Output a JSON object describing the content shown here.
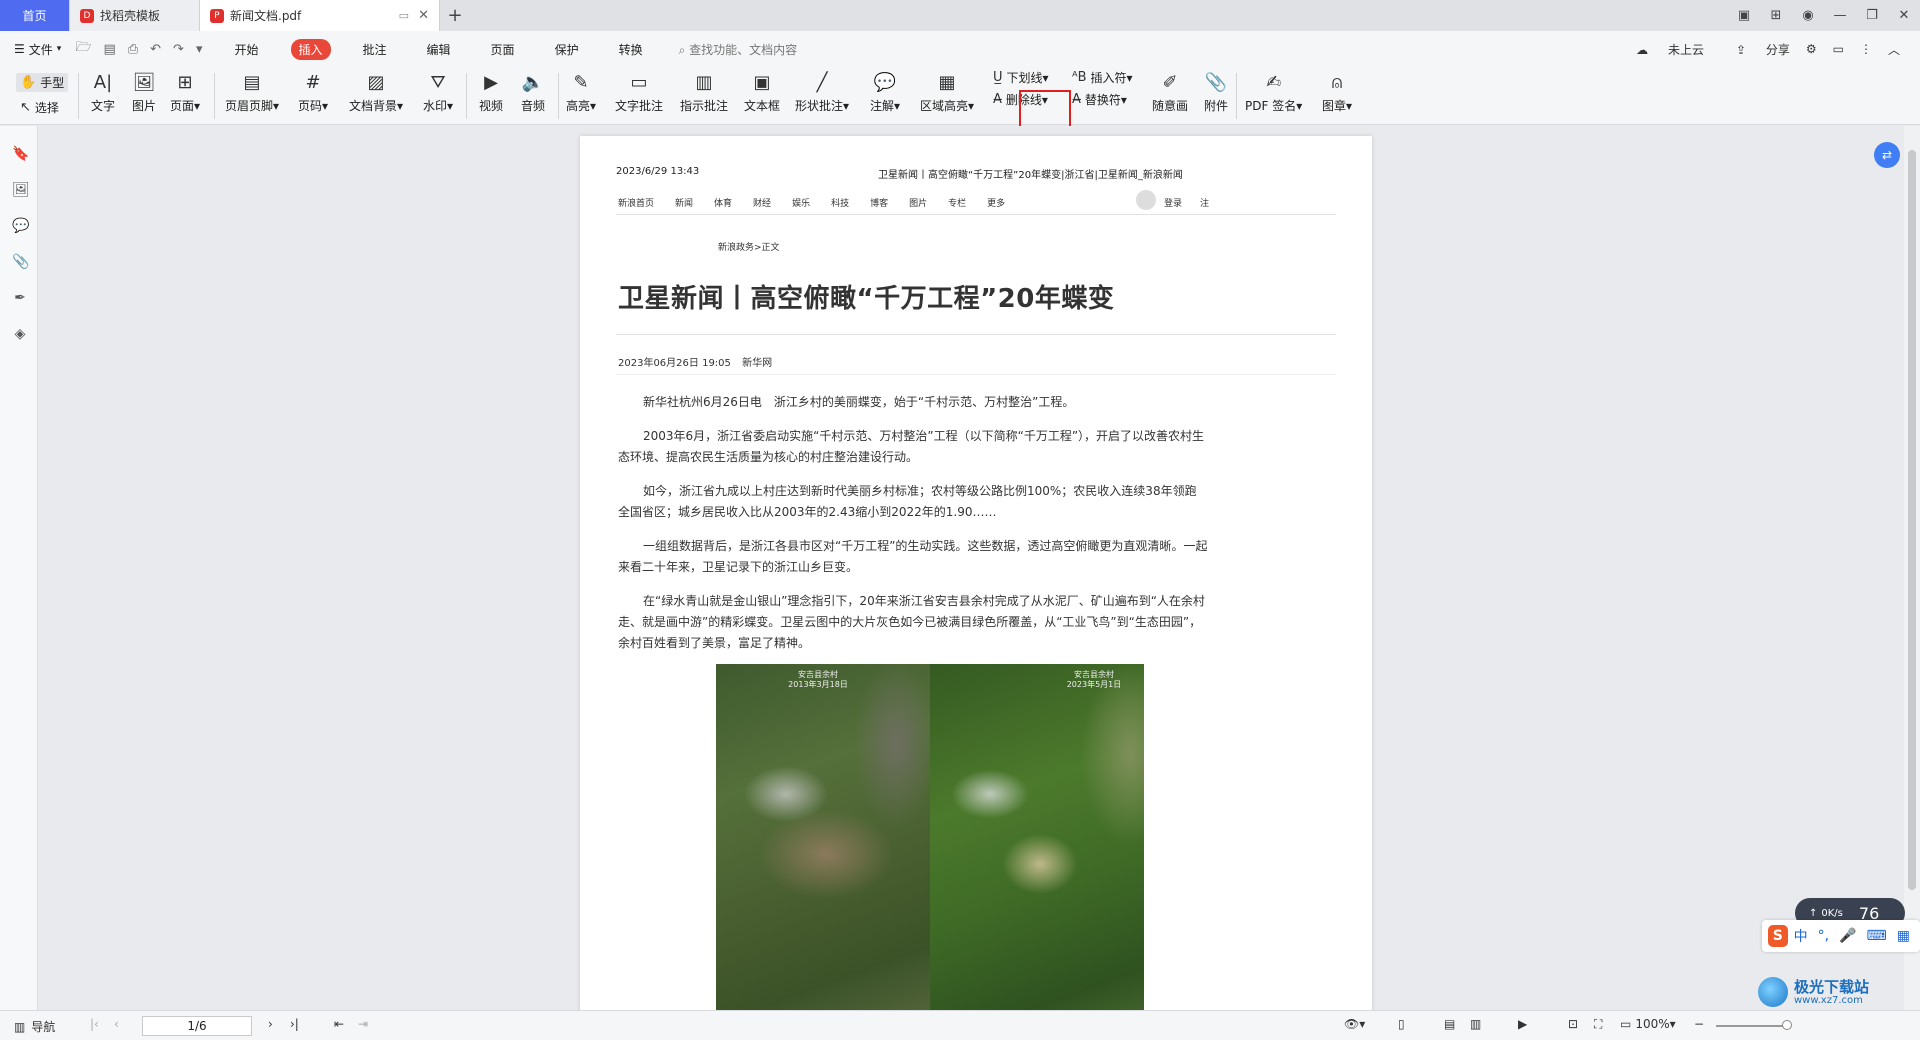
{
  "tabs": {
    "home": "首页",
    "template": "找稻壳模板",
    "doc": "新闻文档.pdf",
    "add": "+"
  },
  "menubar": {
    "file": "文件",
    "tabs": [
      "开始",
      "插入",
      "批注",
      "编辑",
      "页面",
      "保护",
      "转换"
    ],
    "active_tab": "插入",
    "search": "查找功能、文档内容",
    "cloud": "未上云",
    "share": "分享"
  },
  "toolbar": {
    "hand": "手型",
    "select": "选择",
    "items": [
      "文字",
      "图片",
      "页面",
      "页眉页脚",
      "页码",
      "文档背景",
      "水印",
      "视频",
      "音频",
      "高亮",
      "文字批注",
      "指示批注",
      "文本框",
      "形状批注",
      "注解",
      "区域高亮"
    ],
    "underline": "下划线",
    "strikethrough": "删除线",
    "insert_mark": "插入符",
    "replace_mark": "替换符",
    "freehand": "随意画",
    "attachment": "附件",
    "pdf_sign": "PDF 签名",
    "stamp": "图章"
  },
  "document": {
    "header_date": "2023/6/29 13:43",
    "header_title": "卫星新闻丨高空俯瞰“千万工程”20年蝶变|浙江省|卫星新闻_新浪新闻",
    "nav": [
      "新浪首页",
      "新闻",
      "体育",
      "财经",
      "娱乐",
      "科技",
      "博客",
      "图片",
      "专栏",
      "更多"
    ],
    "login": "登录",
    "register": "注",
    "breadcrumb": "新浪政务>正文",
    "title": "卫星新闻丨高空俯瞰“千万工程”20年蝶变",
    "meta_date": "2023年06月26日 19:05",
    "meta_source": "新华网",
    "paragraphs": [
      "新华社杭州6月26日电　浙江乡村的美丽蝶变，始于“千村示范、万村整治”工程。",
      "2003年6月，浙江省委启动实施“千村示范、万村整治”工程（以下简称“千万工程”），开启了以改善农村生态环境、提高农民生活质量为核心的村庄整治建设行动。",
      "如今，浙江省九成以上村庄达到新时代美丽乡村标准；农村等级公路比例100%；农民收入连续38年领跑全国省区；城乡居民收入比从2003年的2.43缩小到2022年的1.90……",
      "一组组数据背后，是浙江各县市区对“千万工程”的生动实践。这些数据，透过高空俯瞰更为直观清晰。一起来看二十年来，卫星记录下的浙江山乡巨变。",
      "在“绿水青山就是金山银山”理念指引下，20年来浙江省安吉县余村完成了从水泥厂、矿山遍布到“人在余村走、就是画中游”的精彩蝶变。卫星云图中的大片灰色如今已被满目绿色所覆盖，从“工业飞鸟”到“生态田园”，余村百姓看到了美景，富足了精神。"
    ],
    "img_caption_left": "安吉县余村\n2013年3月18日",
    "img_caption_right": "安吉县余村\n2023年5月1日"
  },
  "statusbar": {
    "nav": "导航",
    "page": "1/6",
    "zoom": "100%"
  },
  "overlay": {
    "speed": "0K/s",
    "speed_value": "76",
    "ime_lang": "中",
    "watermark_title": "极光下载站",
    "watermark_url": "www.xz7.com"
  }
}
